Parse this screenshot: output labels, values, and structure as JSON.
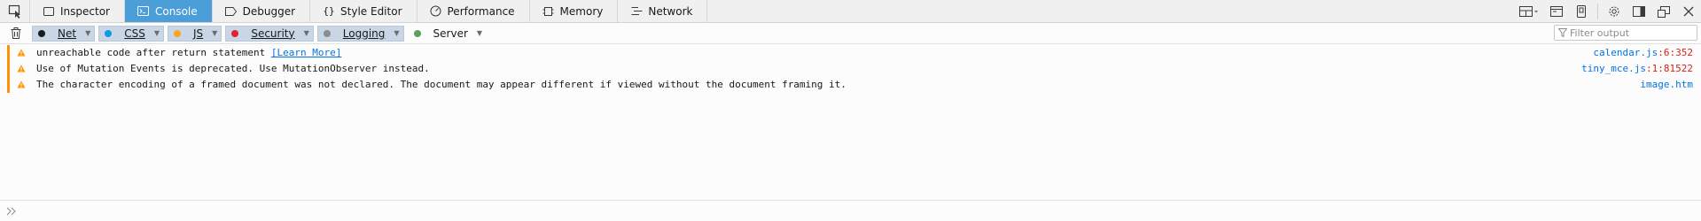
{
  "toolbar": {
    "tabs": [
      {
        "label": "Inspector",
        "selected": false
      },
      {
        "label": "Console",
        "selected": true
      },
      {
        "label": "Debugger",
        "selected": false
      },
      {
        "label": "Style Editor",
        "selected": false
      },
      {
        "label": "Performance",
        "selected": false
      },
      {
        "label": "Memory",
        "selected": false
      },
      {
        "label": "Network",
        "selected": false
      }
    ]
  },
  "filters": {
    "buttons": [
      {
        "label": "Net",
        "color": "#1b1b1b",
        "active": true
      },
      {
        "label": "CSS",
        "color": "#0a9ae6",
        "active": true
      },
      {
        "label": "JS",
        "color": "#f5a623",
        "active": true
      },
      {
        "label": "Security",
        "color": "#e0232e",
        "active": true
      },
      {
        "label": "Logging",
        "color": "#8c8c8c",
        "active": true
      },
      {
        "label": "Server",
        "color": "#5e9e5e",
        "active": false
      }
    ],
    "search_placeholder": "Filter output"
  },
  "messages": [
    {
      "text": "unreachable code after return statement ",
      "link": "[Learn More]",
      "file": "calendar.js",
      "line": ":6:352"
    },
    {
      "text": "Use of Mutation Events is deprecated. Use MutationObserver instead.",
      "link": "",
      "file": "tiny_mce.js",
      "line": ":1:81522"
    },
    {
      "text": "The character encoding of a framed document was not declared. The document may appear different if viewed without the document framing it.",
      "link": "",
      "file": "image.htm",
      "line": ""
    }
  ],
  "colors": {
    "accent": "#4c9ed9",
    "warning": "#ff9400",
    "link": "#0074e8",
    "line_number": "#d92215"
  }
}
